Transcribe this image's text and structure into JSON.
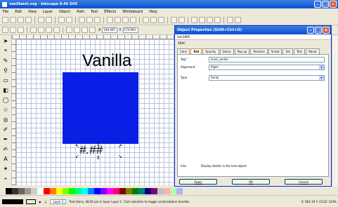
{
  "window": {
    "title": "vanillaext.svg - Inkscape 0.46 SVG"
  },
  "menu": [
    "File",
    "Edit",
    "View",
    "Layer",
    "Object",
    "Path",
    "Text",
    "Effects",
    "Whiteboard",
    "Help"
  ],
  "coords": {
    "x_label": "X",
    "x_value": "146.997",
    "y_label": "Y",
    "y_value": "175.993"
  },
  "canvas": {
    "heading": "Vanilla",
    "selected_text": "#.##"
  },
  "dialog": {
    "title": "Object Properties (Shift+Ctrl+O)",
    "subtitle": "text3899",
    "section_label": "XBAC",
    "tabs": [
      "Color",
      "Std",
      "Opacity",
      "Query",
      "Pop-up",
      "Rename",
      "Script",
      "Set",
      "Test",
      "About"
    ],
    "active_tab": "Std",
    "fields": {
      "tag_label": "Tag*",
      "tag_value": "level_vanilla",
      "align_label": "Alignment",
      "align_value": "Right",
      "type_label": "Type",
      "type_value": "Serial"
    },
    "info_label": "Info:",
    "info_text": "Display details in the text object.",
    "buttons": {
      "apply": "Apply",
      "ok": "OK",
      "cancel": "Cancel"
    }
  },
  "statusbar": {
    "layer": "Layer 1",
    "message": "Text (Sans, 48.00 px) in layer Layer 1. Click selection to toggle scale/rotation handles.",
    "coords": "X: 661.19  Y: 213.",
    "zoom": "Z: 124%"
  },
  "palette": [
    "#000000",
    "#333333",
    "#666666",
    "#999999",
    "#cccccc",
    "#ffffff",
    "#ff0000",
    "#ff7f00",
    "#ffff00",
    "#7fff00",
    "#00ff00",
    "#00ff7f",
    "#00ffff",
    "#007fff",
    "#0000ff",
    "#7f00ff",
    "#ff00ff",
    "#ff007f",
    "#800000",
    "#808000",
    "#008000",
    "#008080",
    "#000080",
    "#800080",
    "#c0c0c0",
    "#ffb0b0",
    "#b0ffb0",
    "#b0b0ff"
  ]
}
